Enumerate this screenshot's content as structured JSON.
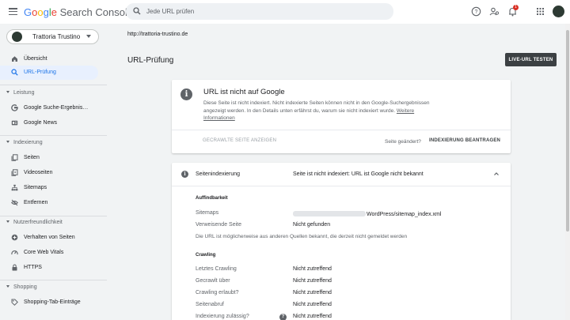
{
  "header": {
    "logo_google": [
      "G",
      "o",
      "o",
      "g",
      "l",
      "e"
    ],
    "logo_suffix": "Search Console",
    "search_placeholder": "Jede URL prüfen",
    "notification_count": "1"
  },
  "sidebar": {
    "property_name": "Trattoria Trustino",
    "items_top": [
      {
        "label": "Übersicht",
        "icon": "home-icon"
      },
      {
        "label": "URL-Prüfung",
        "icon": "search-icon"
      }
    ],
    "sections": [
      {
        "title": "Leistung",
        "items": [
          {
            "label": "Google Suche-Ergebnis…",
            "icon": "google-g-icon"
          },
          {
            "label": "Google News",
            "icon": "news-icon"
          }
        ]
      },
      {
        "title": "Indexierung",
        "items": [
          {
            "label": "Seiten",
            "icon": "pages-icon"
          },
          {
            "label": "Videoseiten",
            "icon": "video-pages-icon"
          },
          {
            "label": "Sitemaps",
            "icon": "sitemap-icon"
          },
          {
            "label": "Entfernen",
            "icon": "remove-icon"
          }
        ]
      },
      {
        "title": "Nutzerfreundlichkeit",
        "items": [
          {
            "label": "Verhalten von Seiten",
            "icon": "plus-circle-icon"
          },
          {
            "label": "Core Web Vitals",
            "icon": "gauge-icon"
          },
          {
            "label": "HTTPS",
            "icon": "lock-icon"
          }
        ]
      },
      {
        "title": "Shopping",
        "items": [
          {
            "label": "Shopping-Tab-Einträge",
            "icon": "tag-icon"
          }
        ]
      }
    ]
  },
  "main": {
    "inspected_url": "http://trattoria-trustino.de",
    "page_title": "URL-Prüfung",
    "live_test_label": "LIVE-URL TESTEN",
    "status_card": {
      "title": "URL ist nicht auf Google",
      "description": "Diese Seite ist nicht indexiert. Nicht indexierte Seiten können nicht in den Google-Suchergebnissen angezeigt werden. In den Details unten erfährst du, warum sie nicht indexiert wurde.",
      "more_info": "Weitere Informationen",
      "view_crawled_label": "GECRAWLTE SEITE ANZEIGEN",
      "page_changed": "Seite geändert?",
      "request_indexing_label": "INDEXIERUNG BEANTRAGEN"
    },
    "indexing_card": {
      "label": "Seitenindexierung",
      "status": "Seite ist nicht indexiert: URL ist Google nicht bekannt",
      "discovery_title": "Auffindbarkeit",
      "sitemaps_key": "Sitemaps",
      "sitemaps_value": "WordPress/sitemap_index.xml",
      "referring_key": "Verweisende Seite",
      "referring_value": "Nicht gefunden",
      "note": "Die URL ist möglicherweise aus anderen Quellen bekannt, die derzeit nicht gemeldet werden",
      "crawling_title": "Crawling",
      "crawl_rows": [
        {
          "key": "Letztes Crawling",
          "value": "Nicht zutreffend"
        },
        {
          "key": "Gecrawlt über",
          "value": "Nicht zutreffend"
        },
        {
          "key": "Crawling erlaubt?",
          "value": "Nicht zutreffend"
        },
        {
          "key": "Seitenabruf",
          "value": "Nicht zutreffend"
        },
        {
          "key": "Indexierung zulässig?",
          "value": "Nicht zutreffend"
        }
      ]
    }
  }
}
